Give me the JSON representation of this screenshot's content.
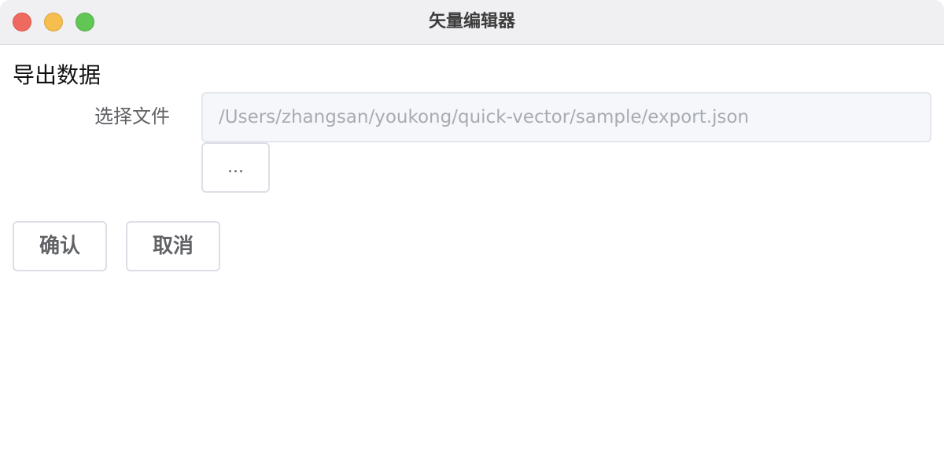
{
  "window": {
    "title": "矢量编辑器"
  },
  "dialog": {
    "section_title": "导出数据",
    "file_label": "选择文件",
    "file_path_value": "/Users/zhangsan/youkong/quick-vector/sample/export.json",
    "browse_label": "...",
    "confirm_label": "确认",
    "cancel_label": "取消"
  },
  "colors": {
    "close": "#ee6a5f",
    "minimize": "#f5be4f",
    "zoom": "#62c655",
    "titlebar_bg": "#f0f0f2",
    "input_bg": "#f5f7fa",
    "input_text": "#a8abb2",
    "button_text": "#606266"
  }
}
